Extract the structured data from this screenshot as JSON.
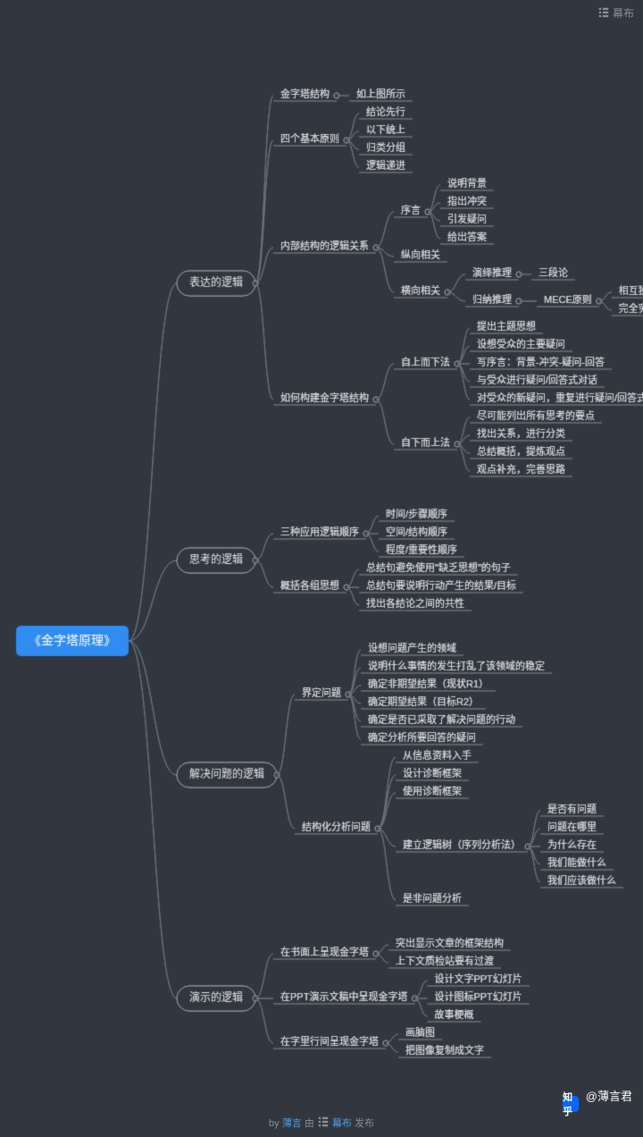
{
  "brand": "幕布",
  "watermark_prefix": "知乎",
  "watermark_user": "@薄言君",
  "credits": {
    "by": "by",
    "author": "薄言",
    "via": "由",
    "service": "幕布",
    "published": "发布"
  },
  "tree": {
    "label": "《金字塔原理》",
    "root": true,
    "children": [
      {
        "label": "表达的逻辑",
        "big": true,
        "children": [
          {
            "label": "金字塔结构",
            "children": [
              {
                "label": "如上图所示"
              }
            ]
          },
          {
            "label": "四个基本原则",
            "children": [
              {
                "label": "结论先行"
              },
              {
                "label": "以下统上"
              },
              {
                "label": "归类分组"
              },
              {
                "label": "逻辑递进"
              }
            ]
          },
          {
            "label": "内部结构的逻辑关系",
            "children": [
              {
                "label": "序言",
                "children": [
                  {
                    "label": "说明背景"
                  },
                  {
                    "label": "指出冲突"
                  },
                  {
                    "label": "引发疑问"
                  },
                  {
                    "label": "给出答案"
                  }
                ]
              },
              {
                "label": "纵向相关"
              },
              {
                "label": "横向相关",
                "children": [
                  {
                    "label": "演绎推理",
                    "children": [
                      {
                        "label": "三段论"
                      }
                    ]
                  },
                  {
                    "label": "归纳推理",
                    "children": [
                      {
                        "label": "MECE原则",
                        "children": [
                          {
                            "label": "相互独立，相互排斥"
                          },
                          {
                            "label": "完全穷尽，没有遗漏"
                          }
                        ]
                      }
                    ]
                  }
                ]
              }
            ]
          },
          {
            "label": "如何构建金字塔结构",
            "children": [
              {
                "label": "自上而下法",
                "children": [
                  {
                    "label": "提出主题思想"
                  },
                  {
                    "label": "设想受众的主要疑问"
                  },
                  {
                    "label": "写序言：背景-冲突-疑问-回答"
                  },
                  {
                    "label": "与受众进行疑问/回答式对话"
                  },
                  {
                    "label": "对受众的新疑问，重复进行疑问/回答式对话"
                  }
                ]
              },
              {
                "label": "自下而上法",
                "children": [
                  {
                    "label": "尽可能列出所有思考的要点"
                  },
                  {
                    "label": "找出关系，进行分类"
                  },
                  {
                    "label": "总结概括，提炼观点"
                  },
                  {
                    "label": "观点补充，完善思路"
                  }
                ]
              }
            ]
          }
        ]
      },
      {
        "label": "思考的逻辑",
        "big": true,
        "children": [
          {
            "label": "三种应用逻辑顺序",
            "children": [
              {
                "label": "时间/步骤顺序"
              },
              {
                "label": "空间/结构顺序"
              },
              {
                "label": "程度/重要性顺序"
              }
            ]
          },
          {
            "label": "概括各组思想",
            "children": [
              {
                "label": "总结句避免使用\"缺乏思想\"的句子"
              },
              {
                "label": "总结句要说明行动产生的结果/目标"
              },
              {
                "label": "找出各结论之间的共性"
              }
            ]
          }
        ]
      },
      {
        "label": "解决问题的逻辑",
        "big": true,
        "children": [
          {
            "label": "界定问题",
            "children": [
              {
                "label": "设想问题产生的领域"
              },
              {
                "label": "说明什么事情的发生打乱了该领域的稳定"
              },
              {
                "label": "确定非期望结果（现状R1）"
              },
              {
                "label": "确定期望结果（目标R2）"
              },
              {
                "label": "确定是否已采取了解决问题的行动"
              },
              {
                "label": "确定分析所要回答的疑问"
              }
            ]
          },
          {
            "label": "结构化分析问题",
            "children": [
              {
                "label": "从信息资料入手"
              },
              {
                "label": "设计诊断框架"
              },
              {
                "label": "使用诊断框架"
              },
              {
                "label": "建立逻辑树（序列分析法）",
                "children": [
                  {
                    "label": "是否有问题"
                  },
                  {
                    "label": "问题在哪里"
                  },
                  {
                    "label": "为什么存在"
                  },
                  {
                    "label": "我们能做什么"
                  },
                  {
                    "label": "我们应该做什么"
                  }
                ]
              },
              {
                "label": "是非问题分析"
              }
            ]
          }
        ]
      },
      {
        "label": "演示的逻辑",
        "big": true,
        "children": [
          {
            "label": "在书面上呈现金字塔",
            "children": [
              {
                "label": "突出显示文章的框架结构"
              },
              {
                "label": "上下文质检站要有过渡"
              }
            ]
          },
          {
            "label": "在PPT演示文稿中呈现金字塔",
            "children": [
              {
                "label": "设计文字PPT幻灯片"
              },
              {
                "label": "设计图标PPT幻灯片"
              },
              {
                "label": "故事梗概"
              }
            ]
          },
          {
            "label": "在字里行间呈现金字塔",
            "children": [
              {
                "label": "画脑图"
              },
              {
                "label": "把图像复制成文字"
              }
            ]
          }
        ]
      }
    ]
  }
}
